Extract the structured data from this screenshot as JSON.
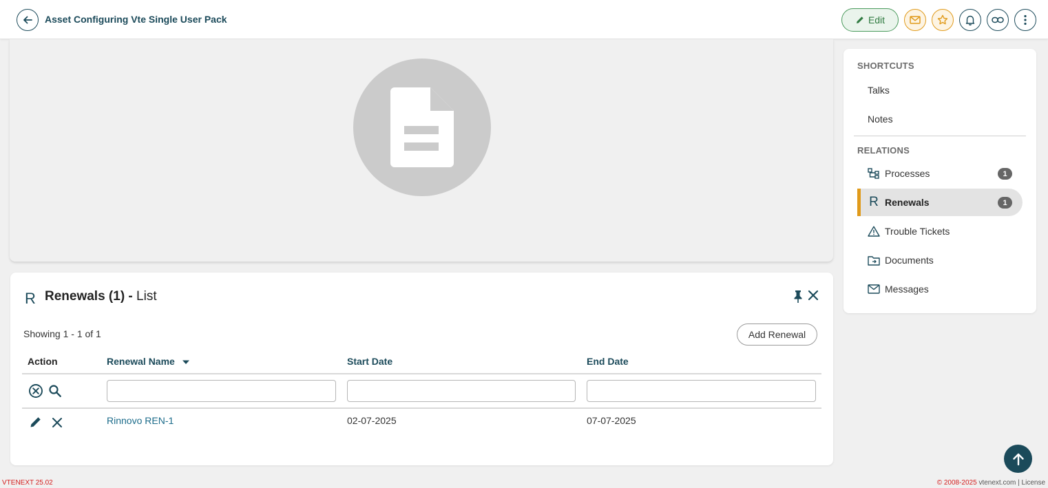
{
  "header": {
    "title": "Asset Configuring Vte Single User Pack",
    "edit_label": "Edit"
  },
  "renewals_panel": {
    "icon_letter": "R",
    "title_bold": "Renewals (1) -",
    "title_suffix": "List",
    "showing": "Showing 1 - 1 of 1",
    "add_button": "Add Renewal",
    "columns": {
      "action": "Action",
      "name": "Renewal Name",
      "start": "Start Date",
      "end": "End Date"
    },
    "filters": {
      "name": "",
      "start": "",
      "end": ""
    },
    "rows": [
      {
        "name": "Rinnovo REN-1",
        "start": "02-07-2025",
        "end": "07-07-2025"
      }
    ]
  },
  "sidebar": {
    "shortcuts_title": "SHORTCUTS",
    "shortcuts": [
      "Talks",
      "Notes"
    ],
    "relations_title": "RELATIONS",
    "relations": [
      {
        "label": "Processes",
        "icon": "processes-icon",
        "count": "1"
      },
      {
        "label": "Renewals",
        "icon": "R",
        "count": "1",
        "active": true
      },
      {
        "label": "Trouble Tickets",
        "icon": "warning-icon"
      },
      {
        "label": "Documents",
        "icon": "folder-icon"
      },
      {
        "label": "Messages",
        "icon": "envelope-icon"
      }
    ]
  },
  "footer": {
    "version": "VTENEXT 25.02",
    "copyright": "© 2008-2025",
    "site": "vtenext.com",
    "separator": "|",
    "license": "License"
  },
  "colors": {
    "primary": "#1b4a5a",
    "accent": "#e09a1a",
    "edit_green": "#2f7a40",
    "footer_red": "#d42020"
  }
}
